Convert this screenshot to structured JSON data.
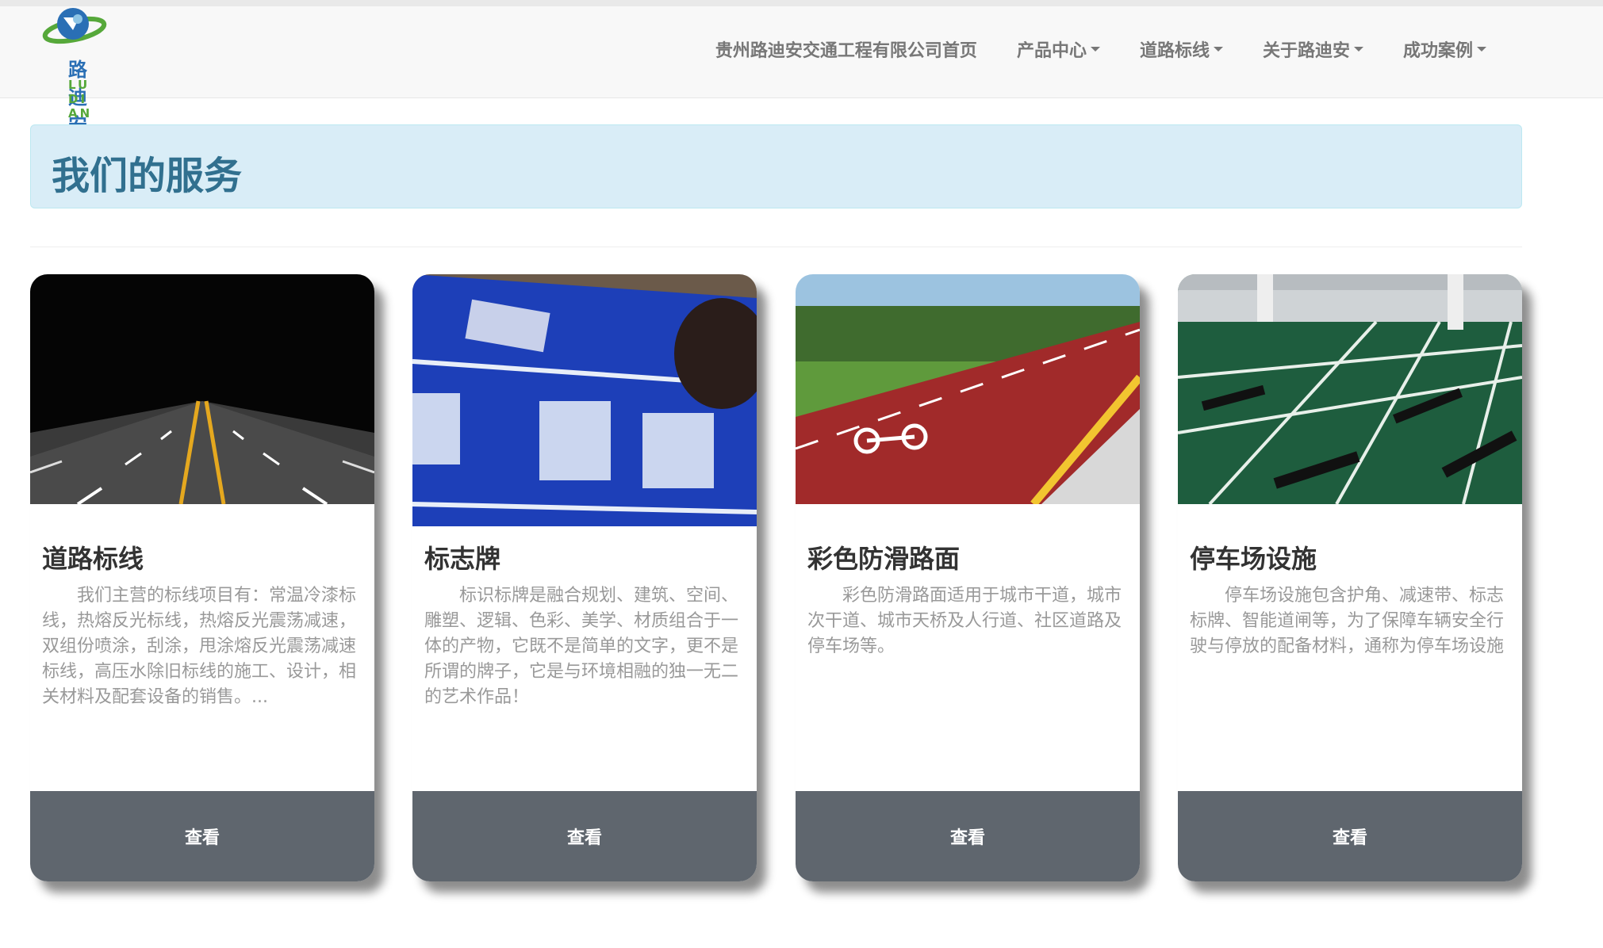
{
  "brand": {
    "logo_text": "路迪安",
    "logo_sub": "LU DI AN"
  },
  "nav": {
    "items": [
      {
        "label": "贵州路迪安交通工程有限公司首页",
        "dropdown": false
      },
      {
        "label": "产品中心",
        "dropdown": true
      },
      {
        "label": "道路标线",
        "dropdown": true
      },
      {
        "label": "关于路迪安",
        "dropdown": true
      },
      {
        "label": "成功案例",
        "dropdown": true
      }
    ]
  },
  "section": {
    "title": "我们的服务"
  },
  "cards": [
    {
      "title": "道路标线",
      "text": "我们主营的标线项目有：常温冷漆标线，热熔反光标线，热熔反光震荡减速，双组份喷涂，刮涂，甩涂熔反光震荡减速标线，高压水除旧标线的施工、设计，相关材料及配套设备的销售。...",
      "button": "查看",
      "image": "road-marking-photo"
    },
    {
      "title": "标志牌",
      "text": "标识标牌是融合规划、建筑、空间、雕塑、逻辑、色彩、美学、材质组合于一体的产物，它既不是简单的文字，更不是所谓的牌子，它是与环境相融的独一无二的艺术作品！",
      "button": "查看",
      "image": "sign-board-photo"
    },
    {
      "title": "彩色防滑路面",
      "text": "彩色防滑路面适用于城市干道，城市次干道、城市天桥及人行道、社区道路及停车场等。",
      "button": "查看",
      "image": "color-pavement-photo"
    },
    {
      "title": "停车场设施",
      "text": "停车场设施包含护角、减速带、标志标牌、智能道闸等，为了保障车辆安全行驶与停放的配备材料，通称为停车场设施",
      "button": "查看",
      "image": "parking-facility-photo"
    }
  ],
  "colors": {
    "alert_bg": "#d9edf7",
    "alert_text": "#31708f",
    "button_bg": "#5f666e",
    "nav_text": "#777777"
  }
}
